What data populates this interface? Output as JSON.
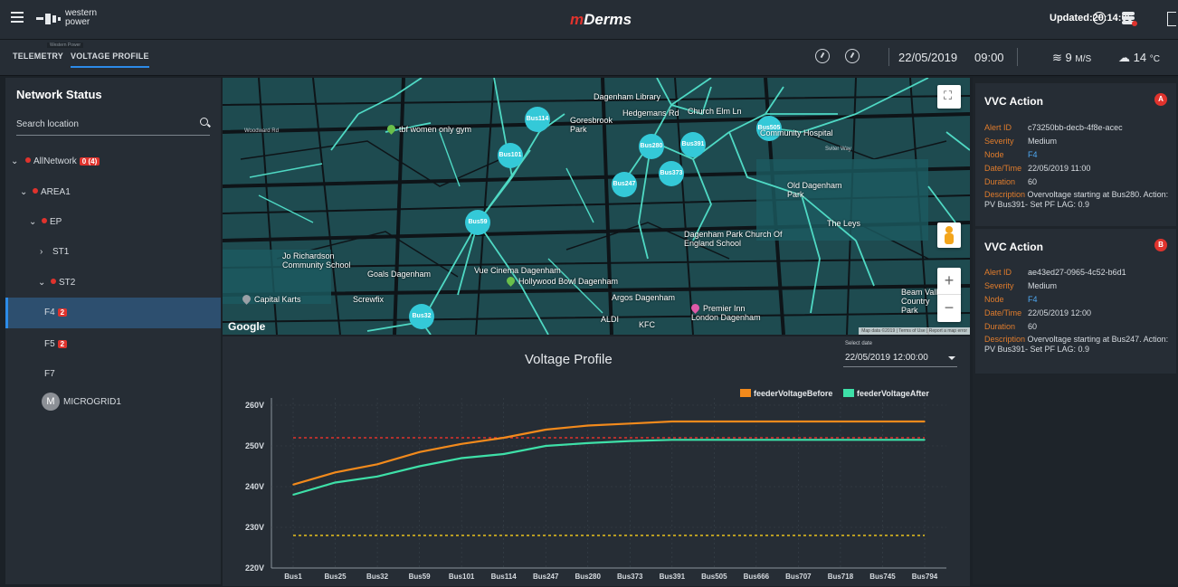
{
  "header": {
    "logo_text": "western\npower",
    "app_title_m": "m",
    "app_title_rest": "Derms",
    "updated": "Updated:20:14:06"
  },
  "tabs": {
    "tooltip": "Western Power",
    "telemetry": "TELEMETRY",
    "voltage_profile": "VOLTAGE PROFILE",
    "date": "22/05/2019",
    "time": "09:00",
    "wind_value": "9",
    "wind_unit": "M/S",
    "temp_value": "14",
    "temp_unit": "°C"
  },
  "network": {
    "title": "Network Status",
    "search_placeholder": "Search location",
    "tree": [
      {
        "label": "AllNetwork",
        "badge": "0 (4)"
      },
      {
        "label": "AREA1"
      },
      {
        "label": "EP"
      },
      {
        "label": "ST1"
      },
      {
        "label": "ST2"
      },
      {
        "label": "F4",
        "badge": "2"
      },
      {
        "label": "F5",
        "badge": "2"
      },
      {
        "label": "F7"
      },
      {
        "label": "MICROGRID1",
        "avatar": "M"
      }
    ]
  },
  "map": {
    "buses": [
      "Bus114",
      "Bus101",
      "Bus280",
      "Bus391",
      "Bus505",
      "Bus247",
      "Bus373",
      "Bus59",
      "Bus32"
    ],
    "places": [
      "Dagenham Library",
      "Hedgemans Rd",
      "Church Elm Ln",
      "tbf women only gym",
      "Goresbrook Park",
      "Old Dagenham Park",
      "The Leys",
      "Dagenham Park Church Of England School",
      "Jo Richardson Community School",
      "Goals Dagenham",
      "Vue Cinema Dagenham",
      "Hollywood Bowl Dagenham",
      "Capital Karts",
      "Screwfix",
      "Argos Dagenham",
      "Premier Inn London Dagenham",
      "KFC",
      "ALDI",
      "Beam Valley Country Park",
      "Sviter Way",
      "Woodward Rd",
      "Community Hospital"
    ],
    "google": "Google",
    "attribution": "Map data ©2019 | Terms of Use | Report a map error"
  },
  "chart_data": {
    "type": "line",
    "title": "Voltage Profile",
    "select_label": "Select date",
    "select_value": "22/05/2019 12:00:00",
    "categories": [
      "Bus1",
      "Bus25",
      "Bus32",
      "Bus59",
      "Bus101",
      "Bus114",
      "Bus247",
      "Bus280",
      "Bus373",
      "Bus391",
      "Bus505",
      "Bus666",
      "Bus707",
      "Bus718",
      "Bus745",
      "Bus794"
    ],
    "series": [
      {
        "name": "feederVoltageBefore",
        "color": "#f28a1c",
        "values": [
          240.5,
          243.5,
          245.5,
          248.5,
          250.5,
          252,
          254,
          255,
          255.5,
          256,
          256,
          256,
          256,
          256,
          256,
          256
        ]
      },
      {
        "name": "feederVoltageAfter",
        "color": "#3ee0a8",
        "values": [
          238,
          241,
          242.5,
          245,
          247,
          248,
          250,
          250.7,
          251.2,
          251.5,
          251.5,
          251.5,
          251.5,
          251.5,
          251.5,
          251.5
        ]
      }
    ],
    "reference_lines": [
      {
        "value": 252,
        "color": "#e0332d"
      },
      {
        "value": 228,
        "color": "#e8c21c"
      }
    ],
    "yticks": [
      "220V",
      "230V",
      "240V",
      "250V",
      "260V"
    ],
    "ylim": [
      220,
      260
    ],
    "grid": true,
    "legend": "top-right"
  },
  "alerts": [
    {
      "title": "VVC Action",
      "badge": "A",
      "alert_id": "c73250bb-decb-4f8e-acec",
      "severity": "Medium",
      "node": "F4",
      "datetime": "22/05/2019 11:00",
      "duration": "60",
      "description": "Overvoltage starting at Bus280. Action: PV Bus391- Set PF LAG: 0.9"
    },
    {
      "title": "VVC Action",
      "badge": "B",
      "alert_id": "ae43ed27-0965-4c52-b6d1",
      "severity": "Medium",
      "node": "F4",
      "datetime": "22/05/2019 12:00",
      "duration": "60",
      "description": "Overvoltage starting at Bus247. Action: PV Bus391- Set PF LAG: 0.9"
    }
  ],
  "alert_labels": {
    "alert_id": "Alert ID",
    "severity": "Severity",
    "node": "Node",
    "datetime": "Date/Time",
    "duration": "Duration",
    "description": "Description"
  }
}
